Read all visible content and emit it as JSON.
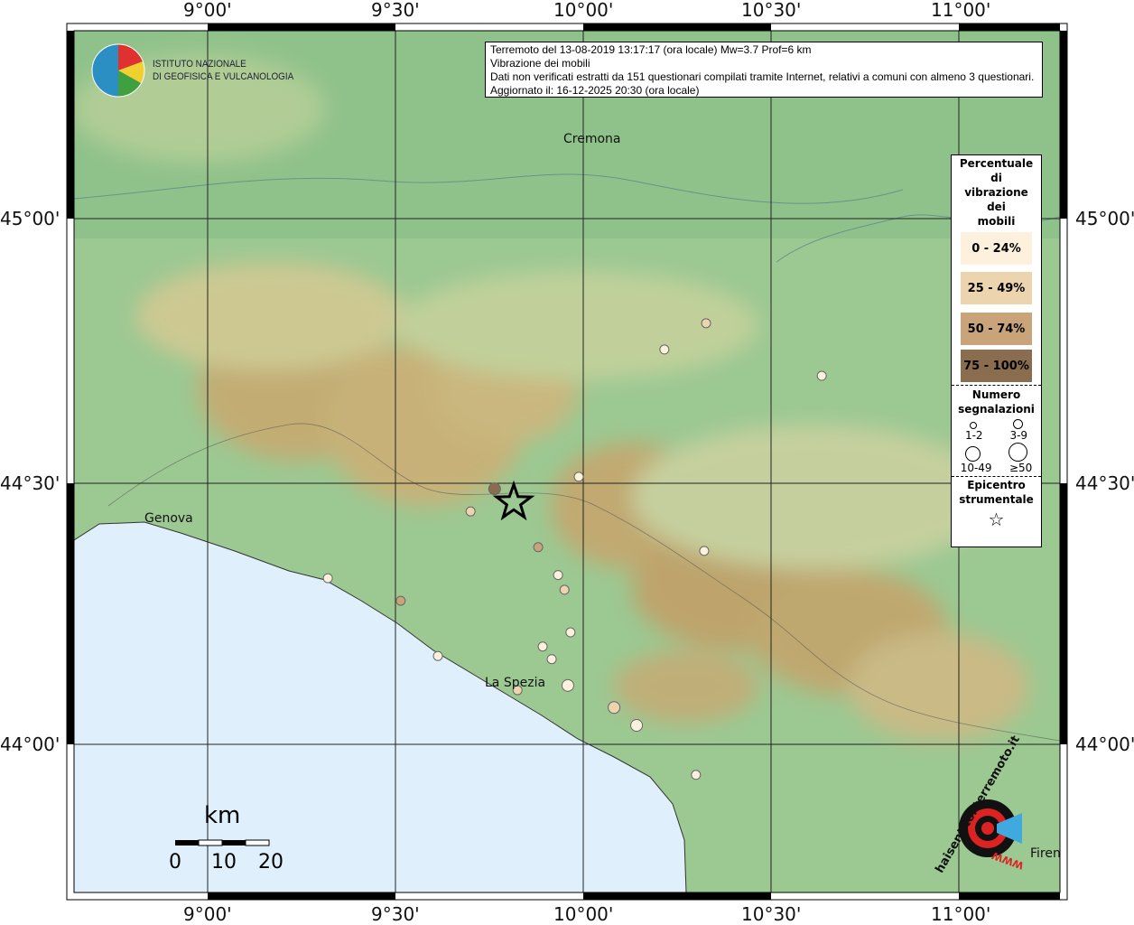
{
  "axes": {
    "lon_ticks": [
      "9°00'",
      "9°30'",
      "10°00'",
      "10°30'",
      "11°00'"
    ],
    "lat_ticks": [
      "45°00'",
      "44°30'",
      "44°00'"
    ]
  },
  "info": {
    "line1": "Terremoto del 13-08-2019 13:17:17 (ora locale) Mw=3.7 Prof=6 km",
    "line2": "Vibrazione dei mobili",
    "line3": "Dati non verificati estratti da 151 questionari compilati tramite Internet, relativi a comuni con almeno 3 questionari.",
    "line4": "Aggiornato il: 16-12-2025 20:30 (ora locale)"
  },
  "logo_ingv": {
    "line1": "ISTITUTO NAZIONALE",
    "line2": "DI GEOFISICA E VULCANOLOGIA"
  },
  "logo_hsit": {
    "text": "haisentitoilterremoto.it",
    "sub": "WWW"
  },
  "cities": [
    {
      "name": "Cremona",
      "lon": 10.02,
      "lat": 45.13
    },
    {
      "name": "Genova",
      "lon": 8.93,
      "lat": 44.41
    },
    {
      "name": "La Spezia",
      "lon": 9.82,
      "lat": 44.11
    },
    {
      "name": "Firen",
      "lon": 11.23,
      "lat": 43.78
    }
  ],
  "legend": {
    "title": [
      "Percentuale",
      "di",
      "vibrazione",
      "dei",
      "mobili"
    ],
    "classes": [
      {
        "label": "0 - 24%",
        "color": "#fdf0dc"
      },
      {
        "label": "25 - 49%",
        "color": "#ecd5ae"
      },
      {
        "label": "50 - 74%",
        "color": "#c9a47a"
      },
      {
        "label": "75 - 100%",
        "color": "#8a6d4e"
      }
    ],
    "count_title": [
      "Numero",
      "segnalazioni"
    ],
    "counts": [
      "1-2",
      "3-9",
      "10-49",
      "≥50"
    ],
    "epicenter_title": [
      "Epicentro",
      "strumentale"
    ]
  },
  "scale": {
    "unit": "km",
    "labels": [
      "0",
      "10",
      "20"
    ]
  },
  "epicenter": {
    "lon": 9.815,
    "lat": 44.46
  },
  "points": [
    {
      "lon": 10.327,
      "lat": 44.801,
      "cls": 1,
      "n": 1
    },
    {
      "lon": 10.216,
      "lat": 44.751,
      "cls": 0,
      "n": 1
    },
    {
      "lon": 10.635,
      "lat": 44.701,
      "cls": 0,
      "n": 1
    },
    {
      "lon": 9.988,
      "lat": 44.509,
      "cls": 0,
      "n": 1
    },
    {
      "lon": 9.764,
      "lat": 44.486,
      "cls": 3,
      "n": 2
    },
    {
      "lon": 9.7,
      "lat": 44.443,
      "cls": 1,
      "n": 1
    },
    {
      "lon": 9.88,
      "lat": 44.375,
      "cls": 2,
      "n": 1
    },
    {
      "lon": 10.322,
      "lat": 44.368,
      "cls": 0,
      "n": 1
    },
    {
      "lon": 9.933,
      "lat": 44.322,
      "cls": 0,
      "n": 1
    },
    {
      "lon": 9.95,
      "lat": 44.294,
      "cls": 1,
      "n": 1
    },
    {
      "lon": 9.32,
      "lat": 44.316,
      "cls": 0,
      "n": 1
    },
    {
      "lon": 9.514,
      "lat": 44.273,
      "cls": 2,
      "n": 1
    },
    {
      "lon": 9.966,
      "lat": 44.213,
      "cls": 0,
      "n": 1
    },
    {
      "lon": 9.892,
      "lat": 44.186,
      "cls": 0,
      "n": 1
    },
    {
      "lon": 9.916,
      "lat": 44.162,
      "cls": 0,
      "n": 1
    },
    {
      "lon": 9.613,
      "lat": 44.168,
      "cls": 0,
      "n": 1
    },
    {
      "lon": 9.825,
      "lat": 44.103,
      "cls": 1,
      "n": 1
    },
    {
      "lon": 9.959,
      "lat": 44.112,
      "cls": 0,
      "n": 2
    },
    {
      "lon": 10.082,
      "lat": 44.07,
      "cls": 1,
      "n": 2
    },
    {
      "lon": 10.142,
      "lat": 44.036,
      "cls": 0,
      "n": 2
    },
    {
      "lon": 10.3,
      "lat": 43.942,
      "cls": 0,
      "n": 1
    }
  ]
}
